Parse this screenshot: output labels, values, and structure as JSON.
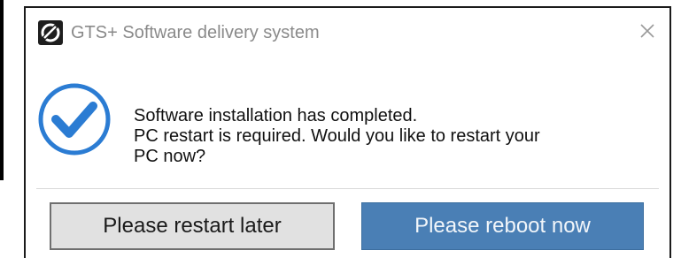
{
  "window": {
    "title": "GTS+ Software delivery system",
    "app_icon": "gts-logo-icon",
    "close_icon": "close-icon"
  },
  "message": {
    "status_icon": "checkmark-circle-icon",
    "line1": "Software installation has completed.",
    "line2": "PC restart is required. Would you like to restart your",
    "line3": "PC now?"
  },
  "buttons": {
    "later_label": "Please restart later",
    "reboot_label": "Please reboot now"
  },
  "colors": {
    "accent": "#4a7fb5",
    "check_blue": "#2b7cd3",
    "title_gray": "#8a8a8a"
  }
}
